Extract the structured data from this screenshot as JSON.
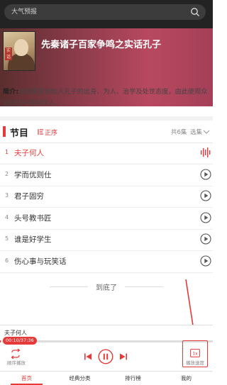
{
  "search": {
    "placeholder": "大气预报"
  },
  "album": {
    "title": "先秦诸子百家争鸣之实话孔子",
    "cover_seal_text": "实话孔子",
    "intro_label": "简介:",
    "intro_text": "讲述儒家创始人孔子的出身、为人、治学及处世态度，由此使观众认识孔子是何许人。"
  },
  "section": {
    "title": "节目",
    "sort_label": "正序",
    "count_label": "共6集",
    "select_label": "选集"
  },
  "tracks": [
    {
      "num": "1",
      "title": "夫子何人",
      "state": "playing"
    },
    {
      "num": "2",
      "title": "学而优则仕",
      "state": "idle"
    },
    {
      "num": "3",
      "title": "君子固穷",
      "state": "idle"
    },
    {
      "num": "4",
      "title": "头号教书匠",
      "state": "idle"
    },
    {
      "num": "5",
      "title": "谁是好学生",
      "state": "idle"
    },
    {
      "num": "6",
      "title": "伤心事与玩笑话",
      "state": "idle"
    }
  ],
  "end_text": "到底了",
  "player": {
    "now_playing": "夫子何人",
    "time": "00:10/37:36",
    "progress_fraction": 0.0044,
    "loop_label": "顺序播放",
    "speed_label": "播放速度",
    "speed_icon_text": "1x"
  },
  "tabs": [
    {
      "label": "首页",
      "active": true
    },
    {
      "label": "经典分类",
      "active": false
    },
    {
      "label": "排行榜",
      "active": false
    },
    {
      "label": "我的",
      "active": false
    }
  ],
  "colors": {
    "accent": "#e6393a",
    "annotation": "#e13a3a"
  }
}
